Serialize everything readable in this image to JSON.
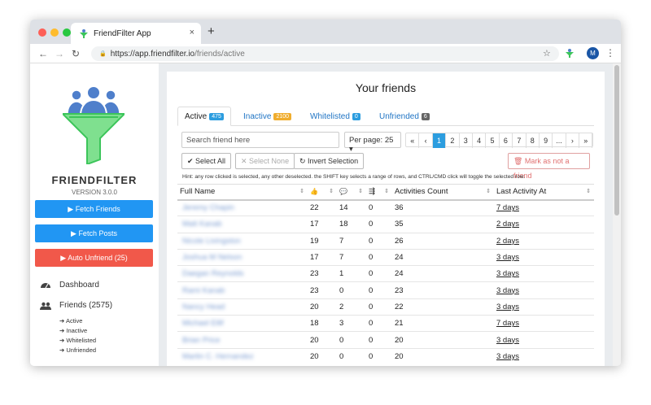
{
  "browser": {
    "tab_title": "FriendFilter App",
    "url_host": "https://app.friendfilter.io",
    "url_path": "/friends/active",
    "profile_initial": "M",
    "close_glyph": "×",
    "new_tab_glyph": "+",
    "back_glyph": "←",
    "forward_glyph": "→",
    "reload_glyph": "↻",
    "lock_glyph": "🔒",
    "star_glyph": "☆",
    "menu_glyph": "⋮"
  },
  "sidebar": {
    "brand": "FRIENDFILTER",
    "version": "VERSION 3.0.0",
    "fetch_friends": "▶ Fetch Friends",
    "fetch_posts": "▶ Fetch Posts",
    "auto_unfriend": "▶ Auto Unfriend (25)",
    "dashboard": "Dashboard",
    "friends": "Friends (2575)",
    "sub_items": [
      "➔ Active",
      "➔ Inactive",
      "➔ Whitelisted",
      "➔ Unfriended"
    ],
    "colors": {
      "blue": "#2196f3",
      "red": "#f1584a",
      "funnel": "#3cc55a",
      "people": "#4f7fcb"
    }
  },
  "main": {
    "title": "Your friends",
    "tabs": [
      {
        "label": "Active",
        "count": "475",
        "color": "#2c9ddf"
      },
      {
        "label": "Inactive",
        "count": "2100",
        "color": "#f0ad2e"
      },
      {
        "label": "Whitelisted",
        "count": "0",
        "color": "#2c9ddf"
      },
      {
        "label": "Unfriended",
        "count": "6",
        "color": "#666666"
      }
    ],
    "search_placeholder": "Search friend here",
    "per_page": "Per page: 25 ▾",
    "pager": [
      "«",
      "‹",
      "1",
      "2",
      "3",
      "4",
      "5",
      "6",
      "7",
      "8",
      "9",
      "...",
      "›",
      "»"
    ],
    "current_page": "1",
    "buttons": {
      "select_all": "✔ Select All",
      "select_none": "✕ Select None",
      "invert": "↻ Invert Selection",
      "mark": "🗑 Mark as not a friend"
    },
    "hint": "Hint: any row clicked is selected, any other deselected. the SHIFT key selects a range of rows, and CTRL/CMD click will toggle the selected row.",
    "columns": [
      "Full Name",
      "👍",
      "💬",
      "⇶",
      "Activities Count",
      "Last Activity At"
    ],
    "sort_glyph": "⇕",
    "rows": [
      {
        "name": "Jeremy Chapin",
        "likes": "22",
        "comments": "14",
        "shares": "0",
        "activities": "36",
        "last": "7 days"
      },
      {
        "name": "Matt Kanab",
        "likes": "17",
        "comments": "18",
        "shares": "0",
        "activities": "35",
        "last": "2 days"
      },
      {
        "name": "Nicole Livingston",
        "likes": "19",
        "comments": "7",
        "shares": "0",
        "activities": "26",
        "last": "2 days"
      },
      {
        "name": "Joshua M Nelson",
        "likes": "17",
        "comments": "7",
        "shares": "0",
        "activities": "24",
        "last": "3 days"
      },
      {
        "name": "Daegan Reynolds",
        "likes": "23",
        "comments": "1",
        "shares": "0",
        "activities": "24",
        "last": "3 days"
      },
      {
        "name": "Rami Kanab",
        "likes": "23",
        "comments": "0",
        "shares": "0",
        "activities": "23",
        "last": "3 days"
      },
      {
        "name": "Nancy Head",
        "likes": "20",
        "comments": "2",
        "shares": "0",
        "activities": "22",
        "last": "3 days"
      },
      {
        "name": "Michael Ellif",
        "likes": "18",
        "comments": "3",
        "shares": "0",
        "activities": "21",
        "last": "7 days"
      },
      {
        "name": "Brian Price",
        "likes": "20",
        "comments": "0",
        "shares": "0",
        "activities": "20",
        "last": "3 days"
      },
      {
        "name": "Martin C. Hernandez",
        "likes": "20",
        "comments": "0",
        "shares": "0",
        "activities": "20",
        "last": "3 days"
      }
    ]
  }
}
